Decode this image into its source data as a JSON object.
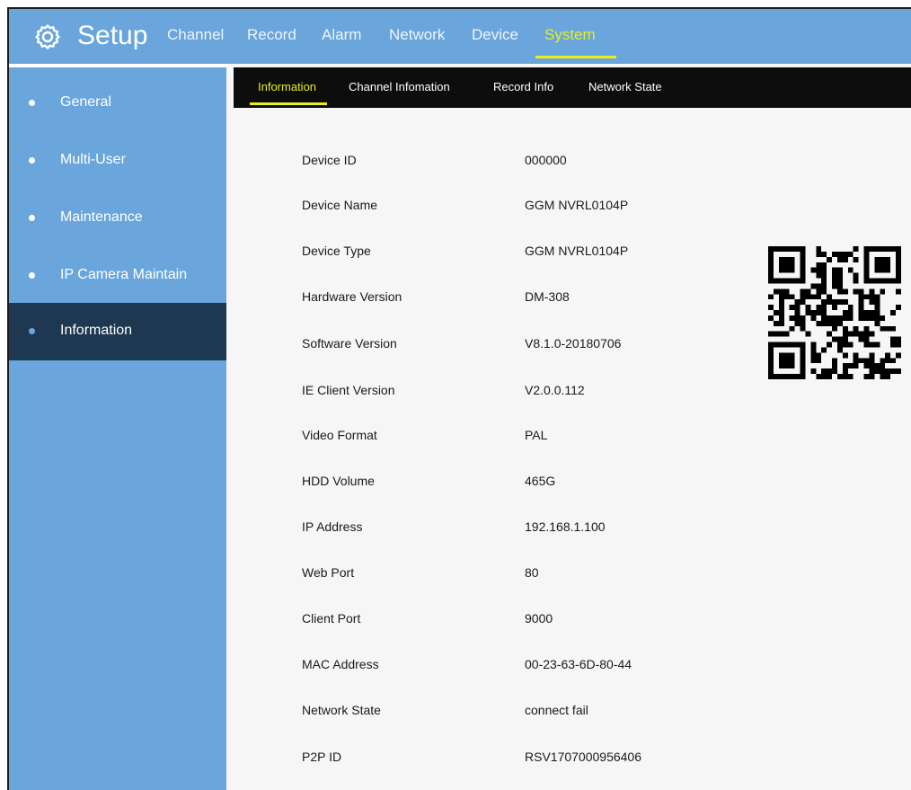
{
  "header": {
    "title": "Setup",
    "icon": "gear-icon",
    "tabs": [
      {
        "label": "Channel",
        "active": false
      },
      {
        "label": "Record",
        "active": false
      },
      {
        "label": "Alarm",
        "active": false
      },
      {
        "label": "Network",
        "active": false
      },
      {
        "label": "Device",
        "active": false
      },
      {
        "label": "System",
        "active": true
      }
    ]
  },
  "sidebar": {
    "items": [
      {
        "label": "General",
        "active": false
      },
      {
        "label": "Multi-User",
        "active": false
      },
      {
        "label": "Maintenance",
        "active": false
      },
      {
        "label": "IP Camera Maintain",
        "active": false
      },
      {
        "label": "Information",
        "active": true
      }
    ]
  },
  "subtabs": [
    {
      "label": "Information",
      "active": true
    },
    {
      "label": "Channel Infomation",
      "active": false
    },
    {
      "label": "Record Info",
      "active": false
    },
    {
      "label": "Network State",
      "active": false
    }
  ],
  "info": [
    {
      "label": "Device ID",
      "value": "000000"
    },
    {
      "label": "Device Name",
      "value": "GGM NVRL0104P"
    },
    {
      "label": "Device Type",
      "value": "GGM NVRL0104P"
    },
    {
      "label": "Hardware Version",
      "value": "DM-308"
    },
    {
      "label": "Software Version",
      "value": "V8.1.0-20180706"
    },
    {
      "label": "IE Client Version",
      "value": "V2.0.0.112"
    },
    {
      "label": "Video Format",
      "value": "PAL"
    },
    {
      "label": "HDD Volume",
      "value": "465G"
    },
    {
      "label": "IP Address",
      "value": "192.168.1.100"
    },
    {
      "label": "Web Port",
      "value": "80"
    },
    {
      "label": "Client Port",
      "value": "9000"
    },
    {
      "label": "MAC Address",
      "value": "00-23-63-6D-80-44"
    },
    {
      "label": "Network State",
      "value": "connect fail"
    },
    {
      "label": "P2P ID",
      "value": "RSV1707000956406"
    }
  ],
  "qr_code": {
    "icon": "qr-code-icon"
  },
  "colors": {
    "header_bg": "#6aa6dc",
    "active_accent": "#e7ee21",
    "sidebar_active_bg": "#1d3850",
    "subtab_bg": "#0d0d0d",
    "content_bg": "#f6f6f6"
  }
}
